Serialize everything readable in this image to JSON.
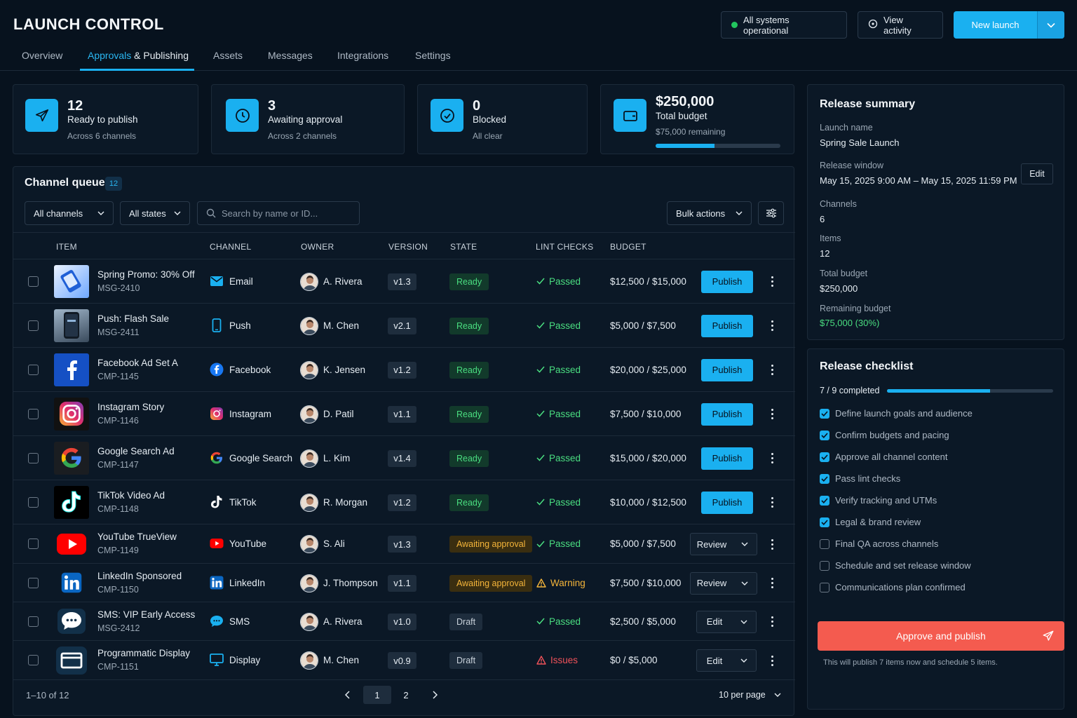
{
  "app": {
    "title": "LAUNCH CONTROL"
  },
  "header": {
    "status": "All systems operational",
    "view_activity": "View activity",
    "new_launch": "New launch"
  },
  "tabs": [
    {
      "label": "Overview"
    },
    {
      "label_a": "Approvals",
      "label_b": "& Publishing",
      "active": true
    },
    {
      "label": "Assets"
    },
    {
      "label": "Messages"
    },
    {
      "label": "Integrations"
    },
    {
      "label": "Settings"
    }
  ],
  "stats": [
    {
      "value": "12",
      "label": "Ready to publish",
      "sub": "Across 6 channels",
      "icon": "paper-plane-icon"
    },
    {
      "value": "3",
      "label": "Awaiting approval",
      "sub": "Across 2 channels",
      "icon": "clock-icon"
    },
    {
      "value": "0",
      "label": "Blocked",
      "sub": "All clear",
      "icon": "check-circle-icon"
    },
    {
      "value": "$250,000",
      "label": "Total budget",
      "sub": "$75,000 remaining",
      "icon": "wallet-icon",
      "progress": 0.47
    }
  ],
  "queue": {
    "title": "Channel queue",
    "count": "12",
    "filters": {
      "channels": "All channels",
      "states": "All states"
    },
    "search_placeholder": "Search by name or ID...",
    "bulk_actions": "Bulk actions",
    "columns": [
      "ITEM",
      "CHANNEL",
      "OWNER",
      "VERSION",
      "STATE",
      "LINT CHECKS",
      "BUDGET"
    ],
    "rows": [
      {
        "name": "Spring Promo: 30% Off",
        "id": "MSG-2410",
        "channel": "Email",
        "channel_icon": "email-icon",
        "owner": "A. Rivera",
        "version": "v1.3",
        "state": "Ready",
        "state_kind": "ready",
        "lint": "Passed",
        "lint_kind": "passed",
        "budget": "$12,500 / $15,000",
        "action": "Publish",
        "action_kind": "primary",
        "thumb": "email-thumb"
      },
      {
        "name": "Push: Flash Sale",
        "id": "MSG-2411",
        "channel": "Push",
        "channel_icon": "phone-icon",
        "owner": "M. Chen",
        "version": "v2.1",
        "state": "Ready",
        "state_kind": "ready",
        "lint": "Passed",
        "lint_kind": "passed",
        "budget": "$5,000 / $7,500",
        "action": "Publish",
        "action_kind": "primary",
        "thumb": "phone-thumb"
      },
      {
        "name": "Facebook Ad Set A",
        "id": "CMP-1145",
        "channel": "Facebook",
        "channel_icon": "facebook-icon",
        "owner": "K. Jensen",
        "version": "v1.2",
        "state": "Ready",
        "state_kind": "ready",
        "lint": "Passed",
        "lint_kind": "passed",
        "budget": "$20,000 / $25,000",
        "action": "Publish",
        "action_kind": "primary",
        "thumb": "facebook-thumb"
      },
      {
        "name": "Instagram Story",
        "id": "CMP-1146",
        "channel": "Instagram",
        "channel_icon": "instagram-icon",
        "owner": "D. Patil",
        "version": "v1.1",
        "state": "Ready",
        "state_kind": "ready",
        "lint": "Passed",
        "lint_kind": "passed",
        "budget": "$7,500 / $10,000",
        "action": "Publish",
        "action_kind": "primary",
        "thumb": "instagram-thumb"
      },
      {
        "name": "Google Search Ad",
        "id": "CMP-1147",
        "channel": "Google Search",
        "channel_icon": "google-icon",
        "owner": "L. Kim",
        "version": "v1.4",
        "state": "Ready",
        "state_kind": "ready",
        "lint": "Passed",
        "lint_kind": "passed",
        "budget": "$15,000 / $20,000",
        "action": "Publish",
        "action_kind": "primary",
        "thumb": "google-thumb"
      },
      {
        "name": "TikTok Video Ad",
        "id": "CMP-1148",
        "channel": "TikTok",
        "channel_icon": "tiktok-icon",
        "owner": "R. Morgan",
        "version": "v1.2",
        "state": "Ready",
        "state_kind": "ready",
        "lint": "Passed",
        "lint_kind": "passed",
        "budget": "$10,000 / $12,500",
        "action": "Publish",
        "action_kind": "primary",
        "thumb": "tiktok-thumb"
      },
      {
        "name": "YouTube TrueView",
        "id": "CMP-1149",
        "channel": "YouTube",
        "channel_icon": "youtube-icon",
        "owner": "S. Ali",
        "version": "v1.3",
        "state": "Awaiting approval",
        "state_kind": "awaiting",
        "lint": "Passed",
        "lint_kind": "passed",
        "budget": "$5,000 / $7,500",
        "action": "Review",
        "action_kind": "split",
        "thumb": "youtube-thumb"
      },
      {
        "name": "LinkedIn Sponsored",
        "id": "CMP-1150",
        "channel": "LinkedIn",
        "channel_icon": "linkedin-icon",
        "owner": "J. Thompson",
        "version": "v1.1",
        "state": "Awaiting approval",
        "state_kind": "awaiting",
        "lint": "Warning",
        "lint_kind": "warning",
        "budget": "$7,500 / $10,000",
        "action": "Review",
        "action_kind": "split",
        "thumb": "linkedin-thumb"
      },
      {
        "name": "SMS: VIP Early Access",
        "id": "MSG-2412",
        "channel": "SMS",
        "channel_icon": "chat-bubble-icon",
        "owner": "A. Rivera",
        "version": "v1.0",
        "state": "Draft",
        "state_kind": "draft",
        "lint": "Passed",
        "lint_kind": "passed",
        "budget": "$2,500 / $5,000",
        "action": "Edit",
        "action_kind": "split",
        "thumb": "sms-thumb"
      },
      {
        "name": "Programmatic Display",
        "id": "CMP-1151",
        "channel": "Display",
        "channel_icon": "monitor-icon",
        "owner": "M. Chen",
        "version": "v0.9",
        "state": "Draft",
        "state_kind": "draft",
        "lint": "Issues",
        "lint_kind": "issues",
        "budget": "$0 / $5,000",
        "action": "Edit",
        "action_kind": "split",
        "thumb": "display-thumb"
      }
    ],
    "pagination": {
      "info": "1–10 of 12",
      "pages": [
        "1",
        "2"
      ],
      "current": "1",
      "per_page": "10 per page"
    }
  },
  "release_summary": {
    "title": "Release summary",
    "fields": [
      {
        "label": "Launch name",
        "value": "Spring Sale Launch"
      },
      {
        "label": "Release window",
        "value": "May 15, 2025 9:00 AM – May 15, 2025 11:59 PM"
      },
      {
        "label": "Channels",
        "value": "6"
      },
      {
        "label": "Items",
        "value": "12"
      },
      {
        "label": "Total budget",
        "value": "$250,000"
      },
      {
        "label": "Remaining budget",
        "value": "$75,000 (30%)"
      }
    ],
    "edit_label": "Edit"
  },
  "checklist": {
    "title": "Release checklist",
    "progress_text": "7 / 9 completed",
    "progress": 0.62,
    "items": [
      {
        "label": "Define launch goals and audience",
        "done": true
      },
      {
        "label": "Confirm budgets and pacing",
        "done": true
      },
      {
        "label": "Approve all channel content",
        "done": true
      },
      {
        "label": "Pass lint checks",
        "done": true
      },
      {
        "label": "Verify tracking and UTMs",
        "done": true
      },
      {
        "label": "Legal & brand review",
        "done": true
      },
      {
        "label": "Final QA across channels",
        "done": false
      },
      {
        "label": "Schedule and set release window",
        "done": false
      },
      {
        "label": "Communications plan confirmed",
        "done": false
      }
    ]
  },
  "approve": {
    "label": "Approve and publish",
    "note": "This will publish 7 items now and schedule 5 items."
  },
  "colors": {
    "accent": "#1ab0f0",
    "success": "#4ade80",
    "warning": "#f5b53a",
    "danger": "#f0525a",
    "cta": "#f45b4f",
    "background": "#07121e"
  }
}
